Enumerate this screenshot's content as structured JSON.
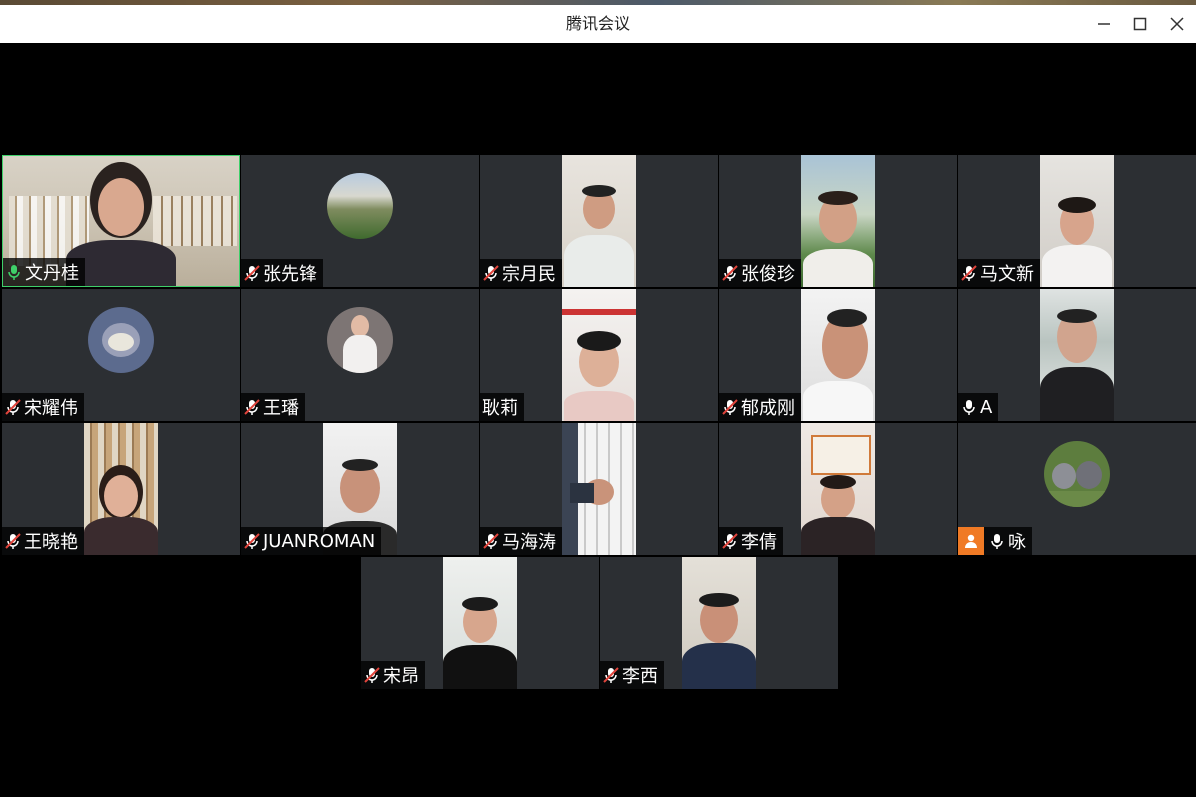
{
  "window": {
    "title": "腾讯会议"
  },
  "participants": [
    {
      "name": "文丹桂",
      "mic": "on",
      "active": true,
      "media": "video"
    },
    {
      "name": "张先锋",
      "mic": "muted",
      "media": "avatar",
      "avatar": "landscape-photo-avatar"
    },
    {
      "name": "宗月民",
      "mic": "muted",
      "media": "video"
    },
    {
      "name": "张俊珍",
      "mic": "muted",
      "media": "video"
    },
    {
      "name": "马文新",
      "mic": "muted",
      "media": "video"
    },
    {
      "name": "宋耀伟",
      "mic": "muted",
      "media": "avatar",
      "avatar": "cartoon-cat-avatar"
    },
    {
      "name": "王璠",
      "mic": "muted",
      "media": "avatar",
      "avatar": "girl-photo-avatar"
    },
    {
      "name": "耿莉",
      "mic": "none",
      "media": "video"
    },
    {
      "name": "郁成刚",
      "mic": "muted",
      "media": "video"
    },
    {
      "name": "A",
      "mic": "on",
      "media": "video"
    },
    {
      "name": "王晓艳",
      "mic": "muted",
      "media": "video"
    },
    {
      "name": "JUANROMAN",
      "mic": "muted",
      "media": "video"
    },
    {
      "name": "马海涛",
      "mic": "muted",
      "media": "video"
    },
    {
      "name": "李倩",
      "mic": "muted",
      "media": "video"
    },
    {
      "name": "咏",
      "mic": "on",
      "host_badge": "user-icon",
      "media": "avatar",
      "avatar": "kittens-photo-avatar"
    },
    {
      "name": "宋昂",
      "mic": "muted",
      "media": "video"
    },
    {
      "name": "李西",
      "mic": "muted",
      "media": "video"
    }
  ],
  "colors": {
    "tile_bg": "#2c2f33",
    "active_border": "#3fd06a",
    "mic_on": "#3fd06a",
    "mic_muted_slash": "#e0443c",
    "host_badge": "#f07a25"
  }
}
